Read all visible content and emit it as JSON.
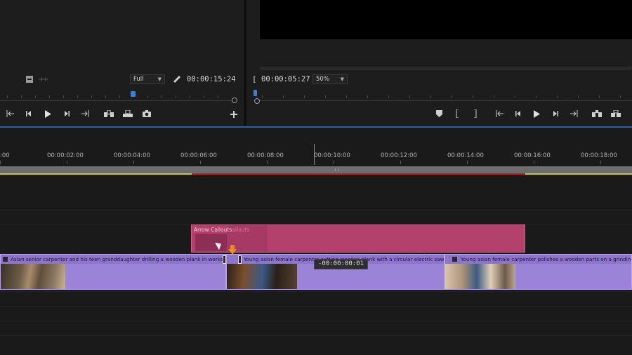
{
  "source_monitor": {
    "zoom": "Full",
    "timecode": "00:00:15:24"
  },
  "program_monitor": {
    "timecode": "00:00:05:27",
    "zoom": "50%"
  },
  "timeline": {
    "ruler_labels": [
      ":00",
      "00:00:02:00",
      "00:00:04:00",
      "00:00:06:00",
      "00:00:08:00",
      "00:00:10:00",
      "00:00:12:00",
      "00:00:14:00",
      "00:00:16:00",
      "00:00:18:00"
    ],
    "graphic_clip": {
      "title": "Arrow Callouts",
      "ghost_title": "allouts"
    },
    "video_clips": [
      {
        "title": "Asian senior carpenter and his teen granddaughter drilling a wooden plank in workshop. Family"
      },
      {
        "title": "Young asian female carpenter cutting wooden plank with a circular electric saw in carpentr"
      },
      {
        "title": "Young asian female carpenter polishes a wooden parts on a grinding machine"
      }
    ],
    "trim_tooltip": "-00:00:00:01"
  },
  "colors": {
    "graphic_clip": "#b3416c",
    "video_clip": "#9b83d8",
    "playhead": "#3e7fd8",
    "work_area_yellow": "#c8c81e",
    "work_area_red": "#c21c1c",
    "trim_arrow": "#e69216"
  },
  "icons": [
    "marker-icon",
    "drag-handle-icon",
    "wrench-icon",
    "go-to-in-icon",
    "step-back-icon",
    "play-icon",
    "step-forward-icon",
    "go-to-out-icon",
    "insert-icon",
    "overwrite-icon",
    "export-frame-icon",
    "add-button-icon",
    "mark-in-icon",
    "mark-out-icon",
    "lift-icon",
    "extract-icon"
  ]
}
